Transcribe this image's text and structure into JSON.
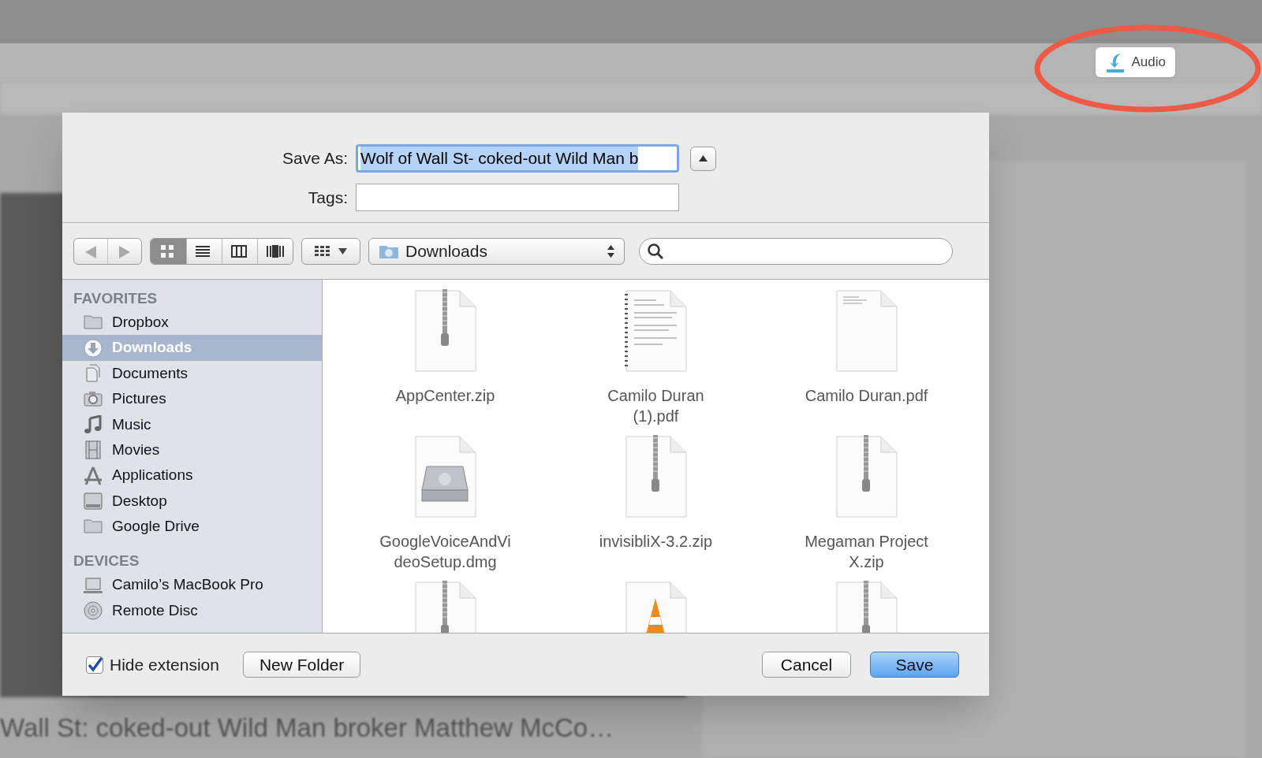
{
  "browser": {
    "audio_button": {
      "label": "Audio"
    },
    "video_title": "Wall St: coked-out Wild Man broker Matthew McCo…"
  },
  "dialog": {
    "save_as": {
      "label": "Save As:",
      "value": "Wolf of Wall St- coked-out Wild Man b"
    },
    "tags": {
      "label": "Tags:"
    },
    "view_modes": [
      {
        "kind": "icons",
        "selected": true
      },
      {
        "kind": "list",
        "selected": false
      },
      {
        "kind": "columns",
        "selected": false
      },
      {
        "kind": "coverflow",
        "selected": false
      }
    ],
    "location": "Downloads",
    "sidebar": [
      {
        "heading": "FAVORITES",
        "items": [
          {
            "label": "Dropbox",
            "kind": "folder",
            "selected": false
          },
          {
            "label": "Downloads",
            "kind": "downloads",
            "selected": true
          },
          {
            "label": "Documents",
            "kind": "documents",
            "selected": false
          },
          {
            "label": "Pictures",
            "kind": "camera",
            "selected": false
          },
          {
            "label": "Music",
            "kind": "music",
            "selected": false
          },
          {
            "label": "Movies",
            "kind": "film",
            "selected": false
          },
          {
            "label": "Applications",
            "kind": "apps",
            "selected": false
          },
          {
            "label": "Desktop",
            "kind": "desktop",
            "selected": false
          },
          {
            "label": "Google Drive",
            "kind": "folder",
            "selected": false
          }
        ]
      },
      {
        "heading": "DEVICES",
        "items": [
          {
            "label": "Camilo’s MacBook Pro",
            "kind": "laptop",
            "selected": false
          },
          {
            "label": "Remote Disc",
            "kind": "disc",
            "selected": false
          }
        ]
      }
    ],
    "files": [
      {
        "name": "AppCenter.zip",
        "kind": "zip"
      },
      {
        "name": "Camilo Duran (1).pdf",
        "kind": "document"
      },
      {
        "name": "Camilo Duran.pdf",
        "kind": "pdf"
      },
      {
        "name": "GoogleVoiceAndVideoSetup.dmg",
        "kind": "dmg"
      },
      {
        "name": "invisibliX-3.2.zip",
        "kind": "zip"
      },
      {
        "name": "Megaman Project X.zip",
        "kind": "zip"
      },
      {
        "kind": "zip"
      },
      {
        "kind": "cone"
      },
      {
        "kind": "zip"
      }
    ],
    "hide_extension": {
      "label": "Hide extension",
      "checked": true
    },
    "buttons": [
      {
        "label": "New Folder",
        "kind": "normal"
      },
      {
        "label": "Cancel",
        "kind": "normal"
      },
      {
        "label": "Save",
        "kind": "default"
      }
    ]
  }
}
